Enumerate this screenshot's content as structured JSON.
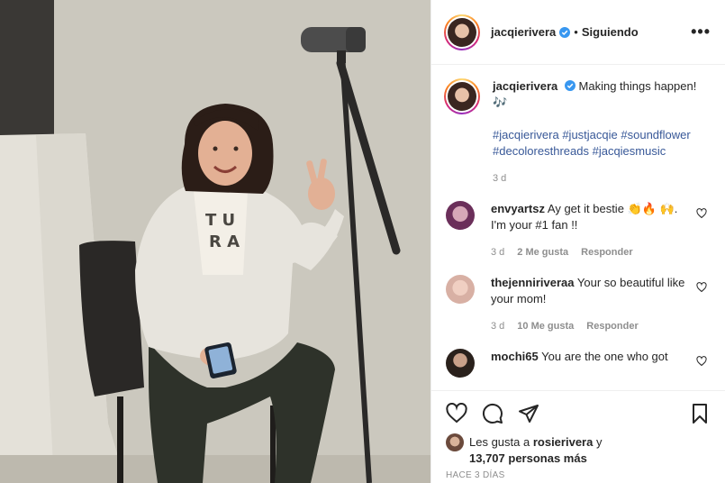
{
  "header": {
    "username": "jacqierivera",
    "separator": "•",
    "follow_status": "Siguiendo",
    "more_icon": "more-horizontal-icon"
  },
  "caption": {
    "username": "jacqierivera",
    "text": "Making things happen! 🎶",
    "hashtags": [
      "#jacqierivera",
      "#justjacqie",
      "#soundflower",
      "#decoloresthreads",
      "#jacqiesmusic"
    ],
    "time": "3 d"
  },
  "comments": [
    {
      "username": "envyartsz",
      "text": "Ay get it bestie 👏🔥 🙌. I'm your #1 fan !!",
      "time": "3 d",
      "likes": "2 Me gusta",
      "reply": "Responder"
    },
    {
      "username": "thejenniriveraa",
      "text": "Your so beautiful like your mom!",
      "time": "3 d",
      "likes": "10 Me gusta",
      "reply": "Responder"
    },
    {
      "username": "mochi65",
      "text": "You are the one who got"
    }
  ],
  "footer": {
    "likes_prefix": "Les gusta a",
    "likes_user": "rosierivera",
    "likes_conj": "y",
    "likes_count": "13,707 personas más",
    "timestamp": "HACE 3 DÍAS"
  },
  "colors": {
    "link": "#385898",
    "muted": "#8e8e8e",
    "verified": "#3897f0"
  }
}
